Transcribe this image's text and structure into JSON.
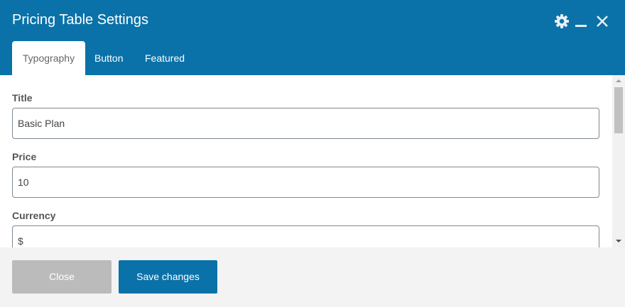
{
  "header": {
    "title": "Pricing Table Settings",
    "tabs": [
      {
        "label": "Typography"
      },
      {
        "label": "Button"
      },
      {
        "label": "Featured"
      }
    ],
    "icons": [
      "gear-icon",
      "minimize-icon",
      "close-icon"
    ]
  },
  "form": {
    "fields": [
      {
        "label": "Title",
        "value": "Basic Plan"
      },
      {
        "label": "Price",
        "value": "10"
      },
      {
        "label": "Currency",
        "value": "$"
      }
    ]
  },
  "footer": {
    "close_label": "Close",
    "save_label": "Save changes"
  },
  "colors": {
    "brand": "#0a72a8",
    "disabled": "#bbbbbb"
  }
}
